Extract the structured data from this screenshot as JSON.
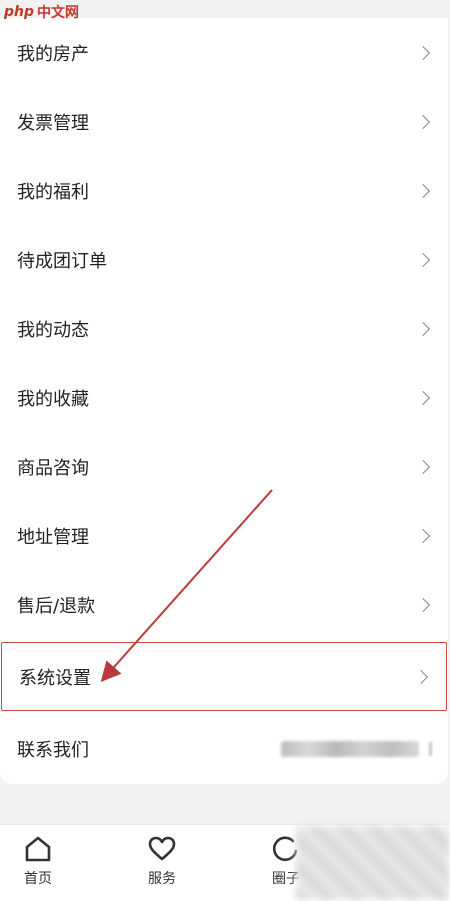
{
  "watermark": {
    "prefix": "php",
    "suffix": "中文网"
  },
  "menu": {
    "items": [
      {
        "label": "我的房产"
      },
      {
        "label": "发票管理"
      },
      {
        "label": "我的福利"
      },
      {
        "label": "待成团订单"
      },
      {
        "label": "我的动态"
      },
      {
        "label": "我的收藏"
      },
      {
        "label": "商品咨询"
      },
      {
        "label": "地址管理"
      },
      {
        "label": "售后/退款"
      },
      {
        "label": "系统设置",
        "highlighted": true
      },
      {
        "label": "联系我们"
      }
    ]
  },
  "tabbar": {
    "tabs": [
      {
        "label": "首页",
        "icon": "home-icon"
      },
      {
        "label": "服务",
        "icon": "heart-icon"
      },
      {
        "label": "圈子",
        "icon": "circle-icon"
      }
    ]
  },
  "colors": {
    "highlight": "#c9494b",
    "background": "#f2f2f2",
    "card": "#ffffff"
  }
}
